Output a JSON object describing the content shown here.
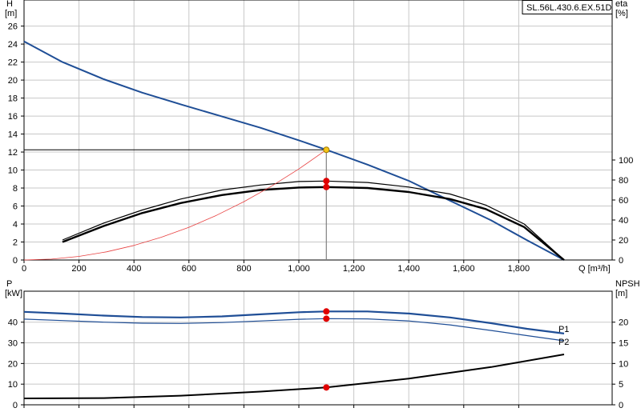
{
  "chart_data": [
    {
      "type": "line",
      "panel": "head-efficiency",
      "title": "",
      "legend_label": "SL.56L.430.6.EX.51D",
      "xlabel": "Q [m³/h]",
      "xlim": [
        0,
        2140
      ],
      "x_ticks": [
        0,
        200,
        400,
        600,
        800,
        1000,
        1200,
        1400,
        1600,
        1800
      ],
      "x_tick_labels": [
        "0",
        "200",
        "400",
        "600",
        "800",
        "1,000",
        "1,200",
        "1,400",
        "1,600",
        "1,800"
      ],
      "ylabel_left": "H",
      "ylabel_left_unit": "[m]",
      "ylim_left": [
        0,
        28.9
      ],
      "y_ticks_left": [
        0,
        2,
        4,
        6,
        8,
        10,
        12,
        14,
        16,
        18,
        20,
        22,
        24,
        26
      ],
      "ylabel_right": "eta",
      "ylabel_right_unit": "[%]",
      "ylim_right": [
        0,
        260
      ],
      "y_ticks_right": [
        0,
        20,
        40,
        60,
        80,
        100
      ],
      "grid": true,
      "series": [
        {
          "axis": "left",
          "color": "#1f4e96",
          "width": 2,
          "x": [
            0,
            140,
            290,
            430,
            570,
            720,
            860,
            1000,
            1100,
            1250,
            1400,
            1550,
            1700,
            1830,
            1965
          ],
          "y": [
            24.3,
            22.0,
            20.1,
            18.6,
            17.3,
            15.95,
            14.7,
            13.3,
            12.25,
            10.6,
            8.8,
            6.6,
            4.4,
            2.2,
            0
          ]
        },
        {
          "axis": "right",
          "color": "#000000",
          "width": 2.4,
          "x": [
            140,
            290,
            430,
            570,
            720,
            860,
            1000,
            1100,
            1250,
            1400,
            1550,
            1680,
            1820,
            1965
          ],
          "y": [
            18,
            34,
            47,
            57,
            65,
            70,
            72.5,
            73,
            72,
            68,
            61,
            51,
            33,
            0
          ]
        },
        {
          "axis": "right",
          "color": "#000000",
          "width": 1.2,
          "x": [
            140,
            290,
            430,
            570,
            720,
            860,
            1000,
            1100,
            1250,
            1400,
            1550,
            1680,
            1820,
            1965
          ],
          "y": [
            20,
            37,
            50,
            61,
            70,
            75,
            78.5,
            79,
            77.5,
            73,
            66,
            55,
            36,
            0
          ]
        },
        {
          "axis": "left",
          "color": "#e84040",
          "width": 0.8,
          "x": [
            0,
            100,
            200,
            300,
            400,
            500,
            600,
            700,
            800,
            900,
            1000,
            1100
          ],
          "y": [
            0,
            0.1,
            0.4,
            0.91,
            1.62,
            2.53,
            3.64,
            4.96,
            6.48,
            8.2,
            10.12,
            12.25
          ]
        }
      ],
      "guides": {
        "horizontal": {
          "y": 12.25,
          "x_from": 0,
          "x_to": 1100,
          "color": "#000000"
        },
        "vertical": {
          "x": 1100,
          "y_from": 0,
          "y_to": 12.25,
          "color": "#808080"
        }
      },
      "duty_points": [
        {
          "x": 1100,
          "y": 12.25,
          "axis": "left",
          "color": "#f5c518",
          "stroke": "#a07800"
        },
        {
          "x": 1100,
          "y": 79,
          "axis": "right",
          "color": "#e00000",
          "stroke": "#e00000"
        },
        {
          "x": 1100,
          "y": 73,
          "axis": "right",
          "color": "#e00000",
          "stroke": "#e00000"
        }
      ]
    },
    {
      "type": "line",
      "panel": "power-npsh",
      "title": "",
      "xlim": [
        0,
        2140
      ],
      "ylabel_left": "P",
      "ylabel_left_unit": "[kW]",
      "ylim_left": [
        0,
        55
      ],
      "y_ticks_left": [
        0,
        10,
        20,
        30,
        40
      ],
      "ylabel_right": "NPSH",
      "ylabel_right_unit": "[m]",
      "ylim_right": [
        0,
        27.5
      ],
      "y_ticks_right": [
        0,
        5,
        10,
        15,
        20
      ],
      "grid": true,
      "series": [
        {
          "name": "P1",
          "axis": "left",
          "color": "#1f4e96",
          "width": 2.2,
          "x": [
            0,
            140,
            290,
            430,
            570,
            720,
            860,
            1000,
            1100,
            1250,
            1400,
            1550,
            1700,
            1830,
            1965
          ],
          "y": [
            45,
            44.2,
            43.2,
            42.5,
            42.3,
            42.8,
            43.8,
            44.8,
            45.2,
            45.2,
            44.2,
            42.3,
            39.5,
            36.8,
            34.5
          ]
        },
        {
          "name": "P2",
          "axis": "left",
          "color": "#1f4e96",
          "width": 1.2,
          "x": [
            0,
            140,
            290,
            430,
            570,
            720,
            860,
            1000,
            1100,
            1250,
            1400,
            1550,
            1700,
            1830,
            1965
          ],
          "y": [
            41.5,
            40.8,
            40,
            39.5,
            39.4,
            39.8,
            40.6,
            41.4,
            41.7,
            41.6,
            40.6,
            38.7,
            36,
            33.5,
            31
          ]
        },
        {
          "axis": "right",
          "color": "#000000",
          "width": 2,
          "x": [
            0,
            290,
            570,
            860,
            1100,
            1400,
            1700,
            1965
          ],
          "y": [
            1.55,
            1.62,
            2.2,
            3.2,
            4.2,
            6.35,
            9.15,
            12.2
          ]
        }
      ],
      "duty_points": [
        {
          "x": 1100,
          "y": 45.2,
          "axis": "left",
          "color": "#e00000",
          "stroke": "#e00000"
        },
        {
          "x": 1100,
          "y": 41.7,
          "axis": "left",
          "color": "#e00000",
          "stroke": "#e00000"
        },
        {
          "x": 1100,
          "y": 4.2,
          "axis": "right",
          "color": "#e00000",
          "stroke": "#e00000"
        }
      ],
      "series_labels": [
        {
          "text": "P1",
          "color": "#1f4e96"
        },
        {
          "text": "P2",
          "color": "#1f4e96"
        }
      ]
    }
  ]
}
